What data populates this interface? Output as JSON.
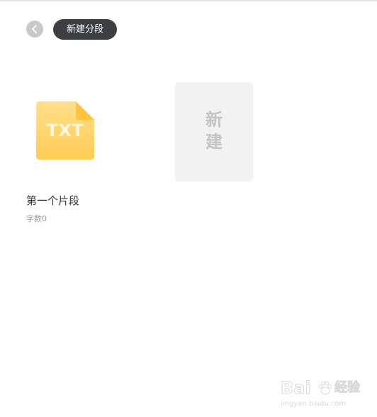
{
  "toolbar": {
    "back_icon": "chevron-left-icon",
    "new_segment_label": "新建分段"
  },
  "files": [
    {
      "icon": "txt-file-icon",
      "icon_label": "TXT",
      "title": "第一个片段",
      "meta": "字数0"
    }
  ],
  "new_card": {
    "label": "新建"
  },
  "watermark": {
    "brand": "Bai",
    "icon": "paw-icon",
    "text": "经验",
    "url": "jingyan.baidu.com"
  },
  "colors": {
    "background": "#ffffff",
    "button_dark": "#3b3f42",
    "back_button": "#c9c9c9",
    "txt_icon": "#ffd46a",
    "new_card_bg": "#f2f2f2",
    "new_card_text": "#c4c4c4"
  }
}
